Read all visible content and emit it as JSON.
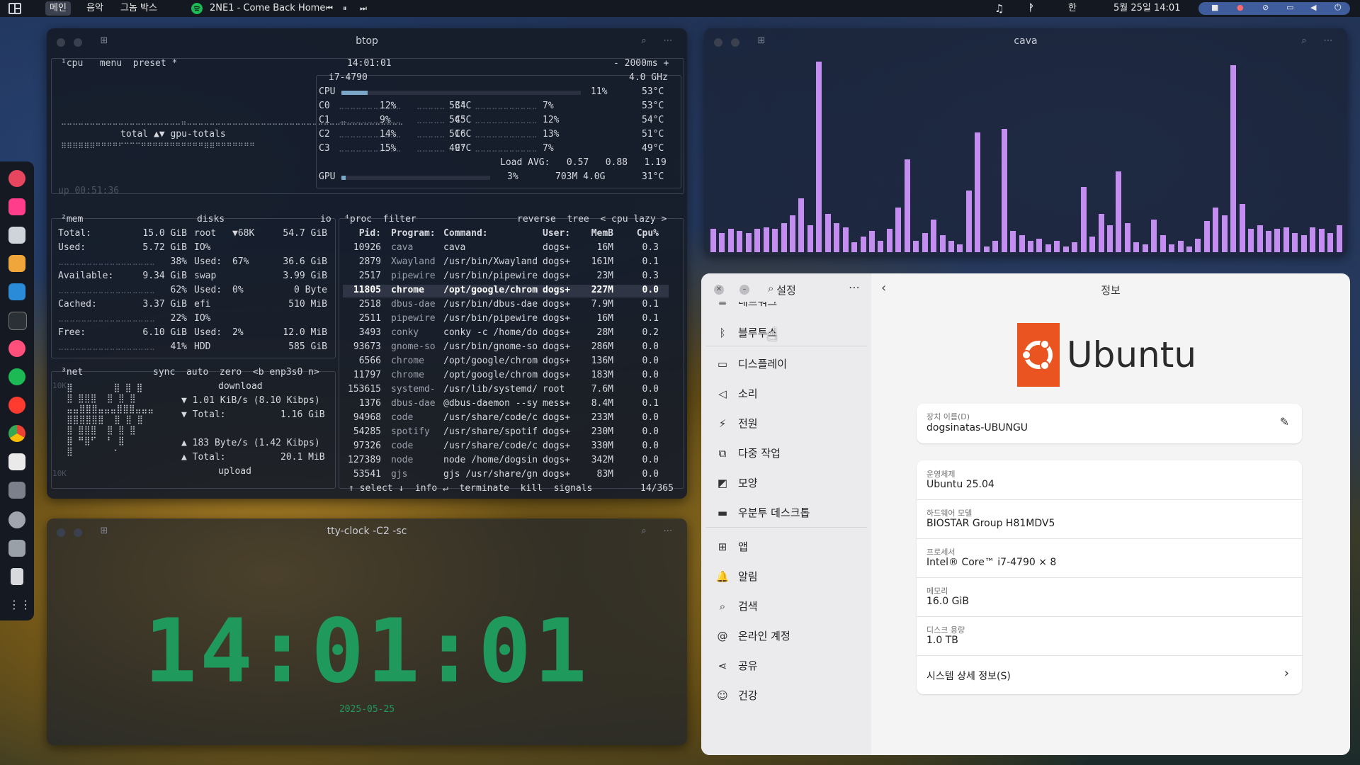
{
  "topbar": {
    "workspaces": [
      "메인",
      "음악",
      "그놈 박스"
    ],
    "now_playing": "2NE1 - Come Back Home",
    "ime": "한",
    "datetime": "5월 25일  14:01"
  },
  "btop": {
    "title": "btop",
    "cpu_header": "¹cpu   menu  preset *",
    "clock": "14:01:01",
    "interval": "- 2000ms +",
    "cpu_model": "i7-4790",
    "freq": "4.0 GHz",
    "cpu_total": {
      "label": "CPU",
      "pct": "11%",
      "temp": "53°C",
      "fill": 0.11
    },
    "cores": [
      {
        "name": "C0",
        "pct": "12%",
        "temp": "53°C"
      },
      {
        "name": "C1",
        "pct": "9%",
        "temp": "54°C"
      },
      {
        "name": "C2",
        "pct": "14%",
        "temp": "51°C"
      },
      {
        "name": "C3",
        "pct": "15%",
        "temp": "49°C"
      },
      {
        "name": "C4",
        "pct": "7%",
        "temp": "53°C"
      },
      {
        "name": "C5",
        "pct": "12%",
        "temp": "54°C"
      },
      {
        "name": "C6",
        "pct": "13%",
        "temp": "51°C"
      },
      {
        "name": "C7",
        "pct": "7%",
        "temp": "49°C"
      }
    ],
    "load_avg": "Load AVG:   0.57   0.88   1.19",
    "gpu": {
      "label": "GPU",
      "pct": "3%",
      "mem": "703M 4.0G",
      "temp": "31°C"
    },
    "graph_label": "total ▲▼ gpu-totals",
    "uptime": "up 00:51:36",
    "mem": {
      "header": "²mem",
      "rows": [
        {
          "k": "Total:",
          "v": "15.0 GiB"
        },
        {
          "k": "Used:",
          "v": "5.72 GiB",
          "p": "38%"
        },
        {
          "k": "Available:",
          "v": "9.34 GiB",
          "p": "62%"
        },
        {
          "k": "Cached:",
          "v": "3.37 GiB",
          "p": "22%"
        },
        {
          "k": "Free:",
          "v": "6.10 GiB",
          "p": "41%"
        }
      ]
    },
    "disks": {
      "header": "disks",
      "io": "io",
      "rows": [
        {
          "k": "root",
          "m": "▼68K",
          "v": "54.7 GiB"
        },
        {
          "k": "IO%",
          "m": "",
          "v": ""
        },
        {
          "k": "Used:",
          "m": "67%",
          "v": "36.6 GiB"
        },
        {
          "k": "swap",
          "m": "",
          "v": "3.99 GiB"
        },
        {
          "k": "Used:",
          "m": "0%",
          "v": "0 Byte"
        },
        {
          "k": "efi",
          "m": "",
          "v": "510 MiB"
        },
        {
          "k": "IO%",
          "m": "",
          "v": ""
        },
        {
          "k": "Used:",
          "m": "2%",
          "v": "12.0 MiB"
        },
        {
          "k": "HDD",
          "m": "",
          "v": "585 GiB"
        }
      ]
    },
    "net": {
      "header": "³net",
      "controls": "sync  auto  zero  <b enp3s0 n>",
      "scale_top": "10K",
      "scale_bottom": "10K",
      "download_label": "download",
      "down_rate": "▼ 1.01 KiB/s (8.10 Kibps)",
      "down_total_k": "▼ Total:",
      "down_total_v": "1.16 GiB",
      "up_rate": "▲ 183 Byte/s (1.42 Kibps)",
      "up_total_k": "▲ Total:",
      "up_total_v": "20.1 MiB",
      "upload_label": "upload"
    },
    "proc": {
      "header": "⁴proc  filter",
      "controls": "reverse  tree  < cpu lazy >",
      "columns": [
        "Pid:",
        "Program:",
        "Command:",
        "User:",
        "MemB",
        "Cpu%"
      ],
      "rows": [
        [
          "10926",
          "cava",
          "cava",
          "dogs+",
          "16M",
          "0.3"
        ],
        [
          "2879",
          "Xwayland",
          "/usr/bin/Xwayland",
          "dogs+",
          "161M",
          "0.1"
        ],
        [
          "2517",
          "pipewire",
          "/usr/bin/pipewire",
          "dogs+",
          "23M",
          "0.3"
        ],
        [
          "11805",
          "chrome",
          "/opt/google/chrom",
          "dogs+",
          "227M",
          "0.0"
        ],
        [
          "2518",
          "dbus-dae",
          "/usr/bin/dbus-dae",
          "dogs+",
          "7.9M",
          "0.1"
        ],
        [
          "2511",
          "pipewire",
          "/usr/bin/pipewire",
          "dogs+",
          "16M",
          "0.1"
        ],
        [
          "3493",
          "conky",
          "conky -c /home/do",
          "dogs+",
          "28M",
          "0.2"
        ],
        [
          "93673",
          "gnome-so",
          "/usr/bin/gnome-so",
          "dogs+",
          "286M",
          "0.0"
        ],
        [
          "6566",
          "chrome",
          "/opt/google/chrom",
          "dogs+",
          "136M",
          "0.0"
        ],
        [
          "11797",
          "chrome",
          "/opt/google/chrom",
          "dogs+",
          "183M",
          "0.0"
        ],
        [
          "153615",
          "systemd-",
          "/usr/lib/systemd/",
          "root",
          "7.6M",
          "0.0"
        ],
        [
          "1376",
          "dbus-dae",
          "@dbus-daemon --sy",
          "mess+",
          "8.4M",
          "0.1"
        ],
        [
          "94968",
          "code",
          "/usr/share/code/c",
          "dogs+",
          "233M",
          "0.0"
        ],
        [
          "54285",
          "spotify",
          "/usr/share/spotif",
          "dogs+",
          "230M",
          "0.0"
        ],
        [
          "97326",
          "code",
          "/usr/share/code/c",
          "dogs+",
          "330M",
          "0.0"
        ],
        [
          "127389",
          "node",
          "node /home/dogsin",
          "dogs+",
          "342M",
          "0.0"
        ],
        [
          "53541",
          "gjs",
          "gjs /usr/share/gn",
          "dogs+",
          "83M",
          "0.0"
        ]
      ],
      "footer": "↑ select ↓  info ↵  terminate  kill  signals",
      "count": "14/365"
    }
  },
  "cava": {
    "title": "cava",
    "levels": [
      0.12,
      0.1,
      0.12,
      0.11,
      0.1,
      0.12,
      0.13,
      0.12,
      0.15,
      0.19,
      0.28,
      0.14,
      0.99,
      0.2,
      0.15,
      0.13,
      0.05,
      0.08,
      0.11,
      0.06,
      0.12,
      0.23,
      0.48,
      0.06,
      0.1,
      0.17,
      0.09,
      0.06,
      0.04,
      0.32,
      0.62,
      0.03,
      0.06,
      0.64,
      0.11,
      0.09,
      0.06,
      0.07,
      0.04,
      0.06,
      0.03,
      0.05,
      0.34,
      0.08,
      0.2,
      0.14,
      0.42,
      0.15,
      0.05,
      0.04,
      0.17,
      0.09,
      0.04,
      0.06,
      0.03,
      0.07,
      0.16,
      0.23,
      0.19,
      0.97,
      0.25,
      0.12,
      0.14,
      0.11,
      0.12,
      0.13,
      0.1,
      0.09,
      0.13,
      0.12,
      0.1,
      0.14
    ]
  },
  "clock": {
    "title": "tty-clock -C2 -sc",
    "time": "14:01:01",
    "date": "2025-05-25"
  },
  "settings": {
    "title": "설정",
    "page_title": "정보",
    "sidebar": [
      {
        "icon": "network-icon",
        "glyph": "≡",
        "label": "네트워크"
      },
      {
        "icon": "bluetooth-icon",
        "glyph": "ᛒ",
        "label": "블루투스"
      },
      {
        "icon": "display-icon",
        "glyph": "▭",
        "label": "디스플레이"
      },
      {
        "icon": "sound-icon",
        "glyph": "◁",
        "label": "소리"
      },
      {
        "icon": "power-icon",
        "glyph": "⚡",
        "label": "전원"
      },
      {
        "icon": "multitasking-icon",
        "glyph": "⧉",
        "label": "다중 작업"
      },
      {
        "icon": "appearance-icon",
        "glyph": "◩",
        "label": "모양"
      },
      {
        "icon": "ubuntu-desktop-icon",
        "glyph": "▬",
        "label": "우분투 데스크톱"
      },
      {
        "icon": "apps-icon",
        "glyph": "⊞",
        "label": "앱"
      },
      {
        "icon": "notifications-icon",
        "glyph": "🔔",
        "label": "알림"
      },
      {
        "icon": "search-icon",
        "glyph": "⌕",
        "label": "검색"
      },
      {
        "icon": "online-accounts-icon",
        "glyph": "@",
        "label": "온라인 계정"
      },
      {
        "icon": "sharing-icon",
        "glyph": "⋖",
        "label": "공유"
      },
      {
        "icon": "wellbeing-icon",
        "glyph": "☺",
        "label": "건강"
      }
    ],
    "logo_text": "Ubuntu",
    "device_name_label": "장치 이름(D)",
    "device_name": "dogsinatas-UBUNGU",
    "info": [
      {
        "label": "운영체제",
        "value": "Ubuntu 25.04"
      },
      {
        "label": "하드웨어 모델",
        "value": "BIOSTAR Group H81MDV5"
      },
      {
        "label": "프로세서",
        "value": "Intel® Core™ i7-4790 × 8"
      },
      {
        "label": "메모리",
        "value": "16.0 GiB"
      },
      {
        "label": "디스크 용량",
        "value": "1.0 TB"
      }
    ],
    "system_details": "시스템 상세 정보(S)"
  },
  "colors": {
    "cava_bar": "#c48df0",
    "clock_green": "#1f9a5c",
    "ubuntu_orange": "#e95420"
  }
}
